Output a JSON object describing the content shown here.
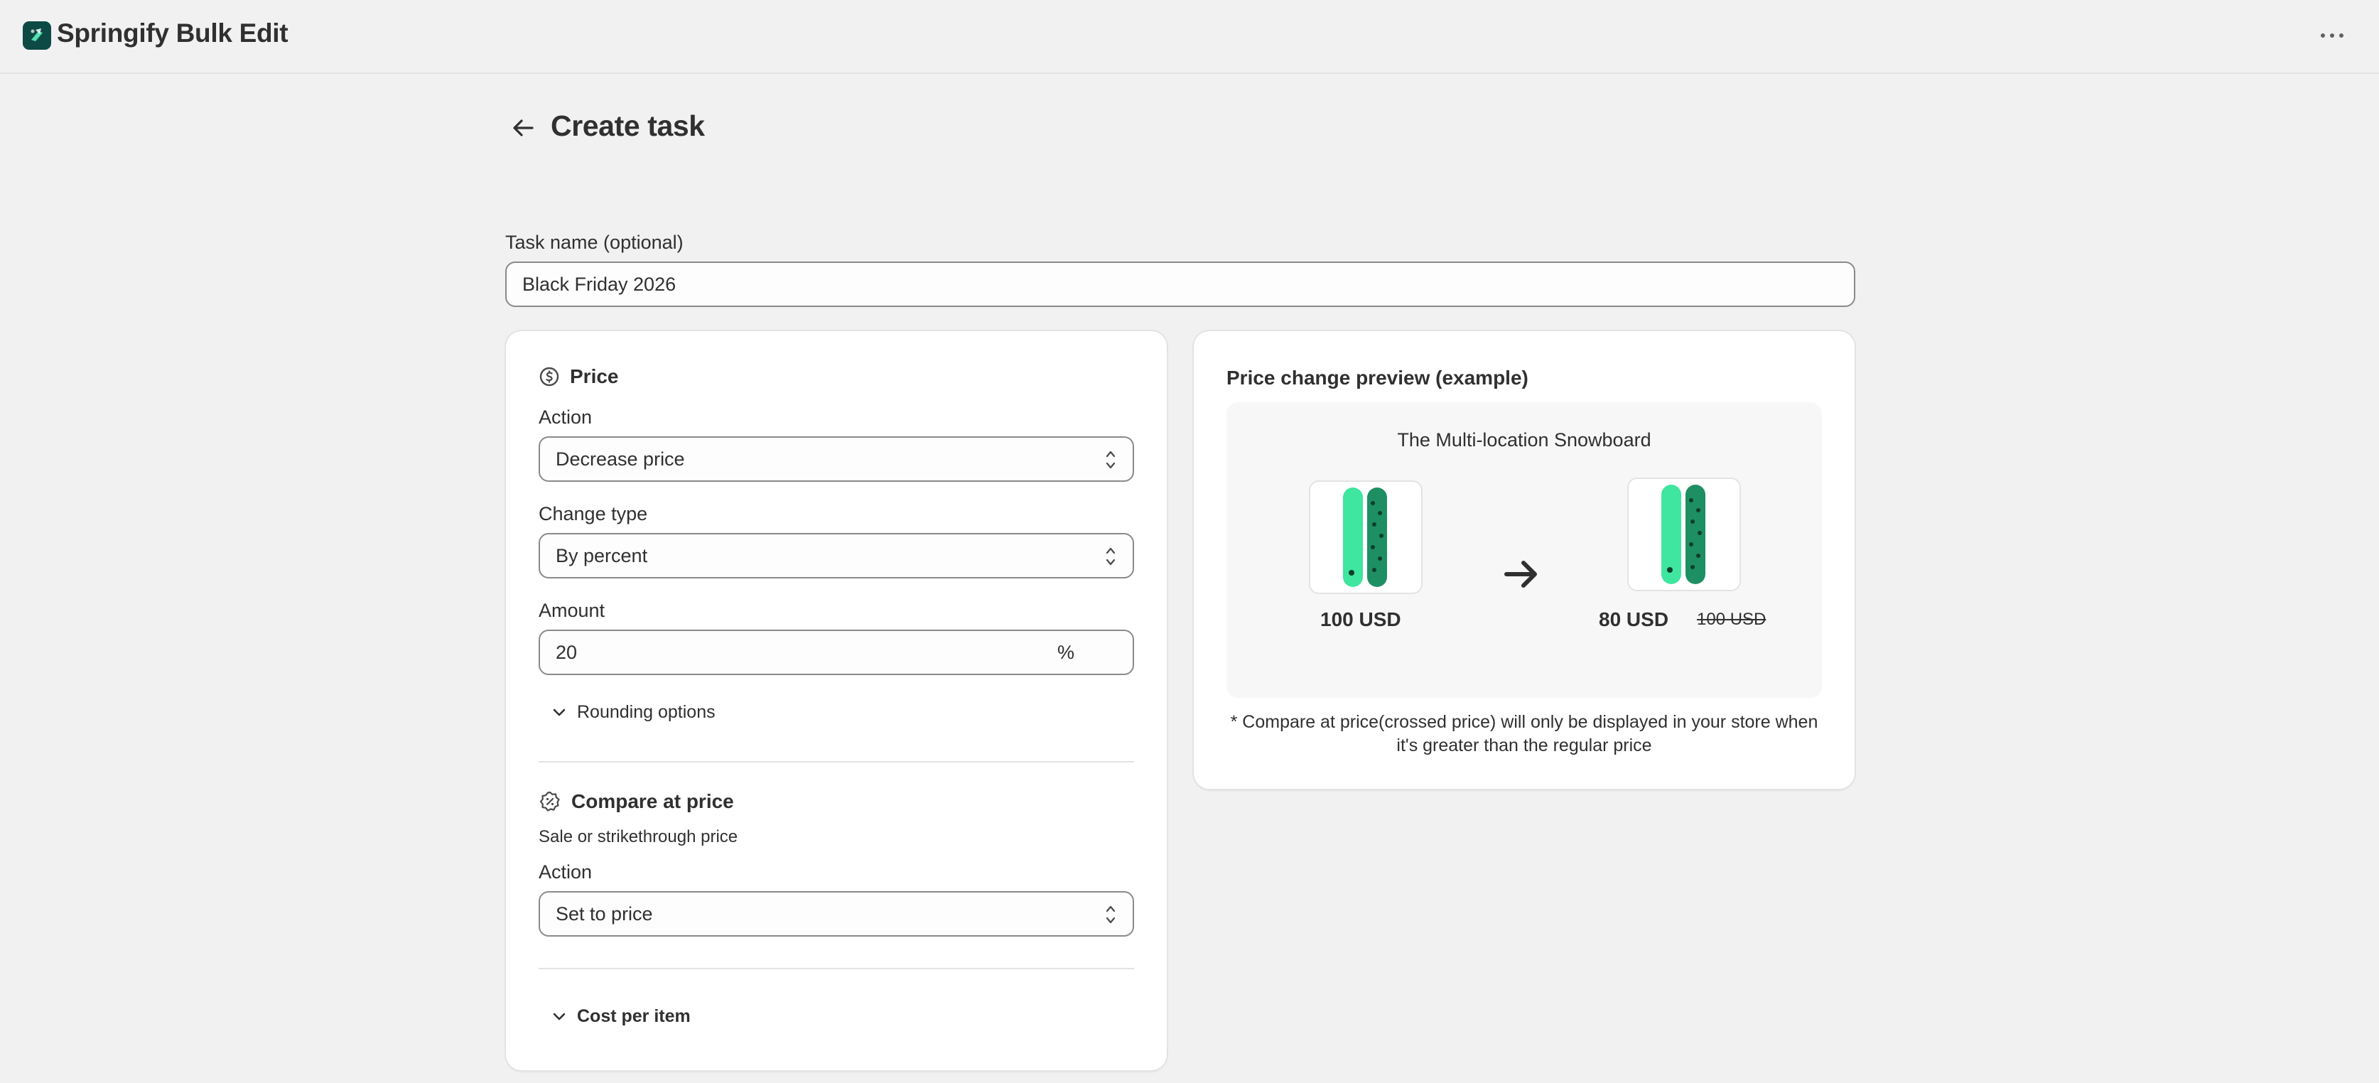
{
  "app": {
    "title": "Springify Bulk Edit",
    "brand_color": "#0d4a45"
  },
  "header": {
    "title": "Create task"
  },
  "task_name": {
    "label": "Task name (optional)",
    "value": "Black Friday 2026"
  },
  "price_section": {
    "title": "Price",
    "action_label": "Action",
    "action_value": "Decrease price",
    "change_type_label": "Change type",
    "change_type_value": "By percent",
    "amount_label": "Amount",
    "amount_value": "20",
    "amount_suffix": "%",
    "rounding_label": "Rounding options"
  },
  "compare_section": {
    "title": "Compare at price",
    "subtitle": "Sale or strikethrough price",
    "action_label": "Action",
    "action_value": "Set to price"
  },
  "cost_section": {
    "label": "Cost per item"
  },
  "preview": {
    "title": "Price change preview (example)",
    "product_name": "The Multi-location Snowboard",
    "old_price": "100 USD",
    "new_price": "80 USD",
    "compare_price": "100 USD",
    "note": "* Compare at price(crossed price) will only be displayed in your store when it's greater than the regular price",
    "board_color": "#3ee6a0",
    "board_dark_color": "#1e8f63"
  }
}
